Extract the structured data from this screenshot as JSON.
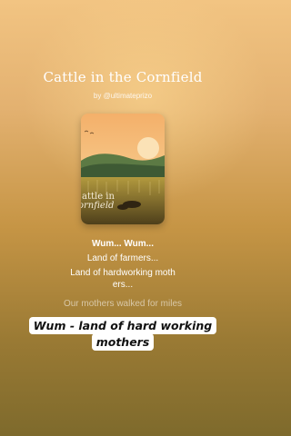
{
  "track": {
    "title": "Cattle in the Cornfield",
    "byline": "by @ultimateprizo"
  },
  "cover": {
    "line1": "attle in",
    "line2": "ornfield"
  },
  "lyrics": {
    "current": "Wum... Wum...",
    "line2": "Land of farmers...",
    "line3a": "Land of hardworking moth",
    "line3b": "ers...",
    "line4": "Our mothers walked for miles"
  },
  "caption": {
    "line1": "Wum - land of hard working",
    "line2": "mothers"
  },
  "colors": {
    "background_top": "#f2c482",
    "background_bottom": "#7e6a2c",
    "caption_bg": "#ffffff"
  }
}
